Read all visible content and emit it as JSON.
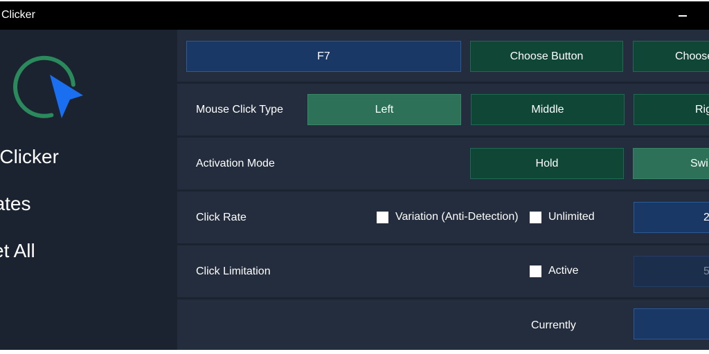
{
  "window": {
    "title": "Clicker"
  },
  "sidebar": {
    "items": [
      {
        "label": "o Clicker"
      },
      {
        "label": "dates"
      },
      {
        "label": "set All"
      }
    ]
  },
  "hotkey": {
    "value": "F7",
    "choose_button_label": "Choose Button",
    "choose_partial_label": "Choose"
  },
  "mouse_click_type": {
    "label": "Mouse Click Type",
    "options": [
      "Left",
      "Middle",
      "Rig"
    ],
    "selected": "Left"
  },
  "activation_mode": {
    "label": "Activation Mode",
    "options": [
      "Hold",
      "Swi"
    ],
    "selected": "Swi"
  },
  "click_rate": {
    "label": "Click Rate",
    "variation_label": "Variation (Anti-Detection)",
    "variation_checked": false,
    "unlimited_label": "Unlimited",
    "unlimited_checked": false,
    "value": "2"
  },
  "click_limitation": {
    "label": "Click Limitation",
    "active_label": "Active",
    "active_checked": false,
    "value": "5"
  },
  "currently": {
    "label": "Currently",
    "value": ""
  },
  "colors": {
    "accent_green": "#2d7258",
    "accent_blue": "#1a3866",
    "logo_ring": "#2a8a5c",
    "logo_cursor": "#1a6ff0"
  },
  "icons": {
    "logo": "clicker-logo-icon",
    "minimize": "minimize-icon",
    "checkbox": "checkbox-icon"
  }
}
